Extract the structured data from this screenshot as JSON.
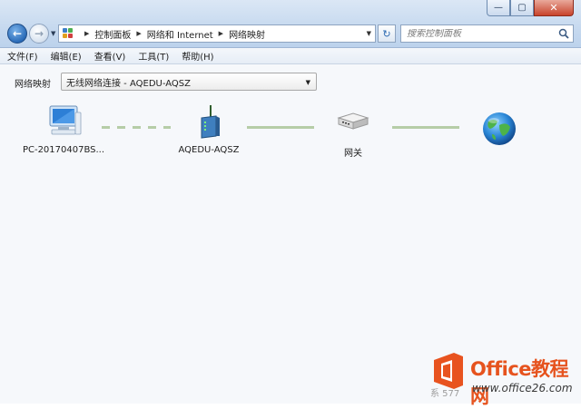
{
  "window": {
    "caption_buttons": {
      "minimize": "—",
      "maximize": "▢",
      "close": "✕"
    }
  },
  "navigation": {
    "breadcrumbs": [
      "控制面板",
      "网络和 Internet",
      "网络映射"
    ],
    "search_placeholder": "搜索控制面板"
  },
  "menu": {
    "items": [
      "文件(F)",
      "编辑(E)",
      "查看(V)",
      "工具(T)",
      "帮助(H)"
    ]
  },
  "network_map": {
    "label": "网络映射",
    "selected_connection": "无线网络连接 - AQEDU-AQSZ",
    "nodes": [
      {
        "label": "PC-20170407BS...",
        "icon": "computer-icon"
      },
      {
        "label": "AQEDU-AQSZ",
        "icon": "wireless-router-icon"
      },
      {
        "label": "网关",
        "icon": "gateway-icon"
      },
      {
        "label": "",
        "icon": "internet-globe-icon"
      }
    ],
    "links": [
      {
        "from": 0,
        "to": 1,
        "type": "wireless"
      },
      {
        "from": 1,
        "to": 2,
        "type": "wired"
      },
      {
        "from": 2,
        "to": 3,
        "type": "wired"
      }
    ],
    "colors": {
      "link": "#b6cda7"
    }
  },
  "watermark": {
    "brand": "Office教程网",
    "url": "www.office26.com",
    "side_text": "系 577"
  }
}
